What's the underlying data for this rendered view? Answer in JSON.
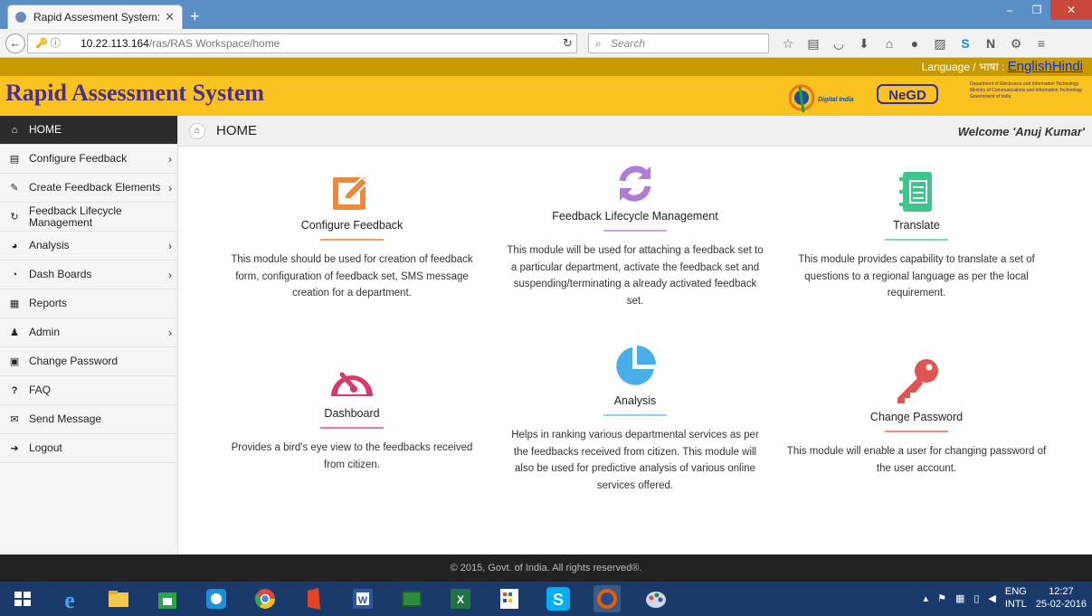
{
  "browser": {
    "tab_title": "Rapid Assesment System: ...",
    "tab_close": "✕",
    "new_tab": "+",
    "url_host": "10.22.113.164",
    "url_path": "/ras/RAS Workspace/home",
    "search_placeholder": "Search",
    "min": "–",
    "max": "❐",
    "close": "✕"
  },
  "langbar": {
    "prefix": "Language / भाषा :",
    "english": "English",
    "hindi": "Hindi"
  },
  "header": {
    "title": "Rapid Assessment System",
    "digital_india": "Digital India",
    "negd": "NeGD",
    "deity_line1": "Department of Electronics and Information Technology",
    "deity_line2": "Ministry of Communications and Information Technology",
    "deity_line3": "Government of India"
  },
  "sidebar": {
    "items": [
      {
        "label": "HOME",
        "icon": "home-icon",
        "glyph": "⌂"
      },
      {
        "label": "Configure Feedback",
        "icon": "file-icon",
        "glyph": "▤"
      },
      {
        "label": "Create Feedback Elements",
        "icon": "pencil-icon",
        "glyph": "✎"
      },
      {
        "label": "Feedback Lifecycle Management",
        "icon": "refresh-icon",
        "glyph": "↻"
      },
      {
        "label": "Analysis",
        "icon": "pie-chart-icon",
        "glyph": "◕"
      },
      {
        "label": "Dash Boards",
        "icon": "dashboard-icon",
        "glyph": "◔"
      },
      {
        "label": "Reports",
        "icon": "reports-icon",
        "glyph": "▦"
      },
      {
        "label": "Admin",
        "icon": "user-icon",
        "glyph": "♟"
      },
      {
        "label": "Change Password",
        "icon": "lock-icon",
        "glyph": "🔒"
      },
      {
        "label": "FAQ",
        "icon": "question-icon",
        "glyph": "?"
      },
      {
        "label": "Send Message",
        "icon": "envelope-icon",
        "glyph": "✉"
      },
      {
        "label": "Logout",
        "icon": "logout-icon",
        "glyph": "➜"
      }
    ],
    "chevron": "›"
  },
  "main": {
    "crumb": "HOME",
    "welcome": "Welcome 'Anuj Kumar'",
    "cards": [
      {
        "title": "Configure Feedback",
        "desc": "This module should be used for creation of feedback form, configuration of feedback set, SMS message creation for a department.",
        "color": "#f0883a",
        "icon": "edit-icon"
      },
      {
        "title": "Feedback Lifecycle Management",
        "desc": "This module will be used for attaching a feedback set to a particular department, activate the feedback set and suspending/terminating a already activated feedback set.",
        "color": "#b07cd6",
        "icon": "refresh-icon"
      },
      {
        "title": "Translate",
        "desc": "This module provides capability to translate a set of questions to a regional language as per the local requirement.",
        "color": "#3fc48c",
        "icon": "notebook-icon"
      },
      {
        "title": "Dashboard",
        "desc": "Provides a bird's eye view to the feedbacks received from citizen.",
        "color": "#d9386a",
        "icon": "dashboard-icon"
      },
      {
        "title": "Analysis",
        "desc": "Helps in ranking various departmental services as per the feedbacks received from citizen. This module will also be used for predictive analysis of various online services offered.",
        "color": "#4aaee8",
        "icon": "pie-chart-icon"
      },
      {
        "title": "Change Password",
        "desc": "This module will enable a user for changing password of the user account.",
        "color": "#e0554f",
        "icon": "key-icon"
      }
    ]
  },
  "footer": {
    "text": "© 2015, Govt. of India. All rights reserved®."
  },
  "taskbar": {
    "lang": "ENG",
    "layout": "INTL",
    "time": "12:27",
    "date": "25-02-2016"
  }
}
